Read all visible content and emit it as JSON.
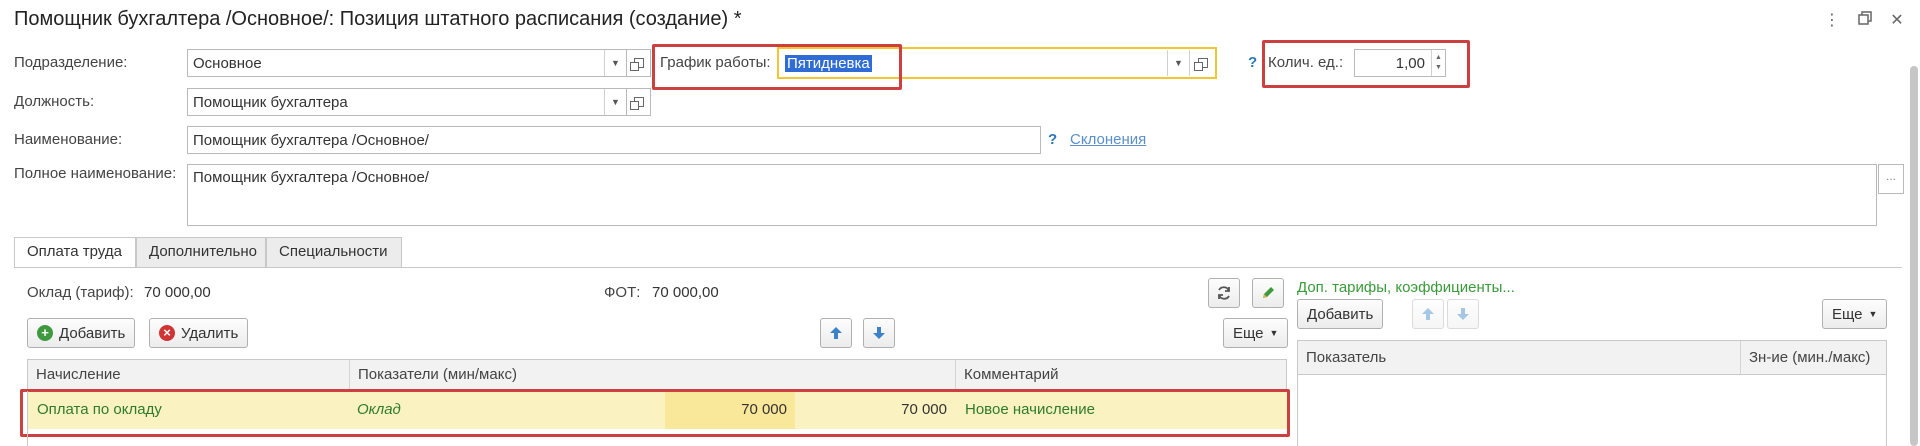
{
  "window": {
    "title": "Помощник бухгалтера /Основное/: Позиция штатного расписания (создание) *",
    "menu_icon": "more-vertical-icon",
    "restore_icon": "restore-window-icon",
    "close_icon": "close-icon"
  },
  "form": {
    "subdivision": {
      "label": "Подразделение:",
      "value": "Основное"
    },
    "position": {
      "label": "Должность:",
      "value": "Помощник бухгалтера"
    },
    "name": {
      "label": "Наименование:",
      "value": "Помощник бухгалтера /Основное/"
    },
    "full_name": {
      "label": "Полное наименование:",
      "value": "Помощник бухгалтера /Основное/"
    },
    "schedule": {
      "label": "График работы:",
      "value": "Пятидневка"
    },
    "quantity": {
      "label": "Колич. ед.:",
      "value": "1,00"
    },
    "declension_link": "Склонения",
    "help": "?"
  },
  "tabs": [
    {
      "label": "Оплата труда",
      "active": true
    },
    {
      "label": "Дополнительно",
      "active": false
    },
    {
      "label": "Специальности",
      "active": false
    }
  ],
  "pay": {
    "salary_label": "Оклад (тариф):",
    "salary_value": "70 000,00",
    "fot_label": "ФОТ:",
    "fot_value": "70 000,00",
    "add_label": "Добавить",
    "delete_label": "Удалить",
    "more_label": "Еще",
    "columns": [
      "Начисление",
      "Показатели (мин/макс)",
      "Комментарий"
    ],
    "rows": [
      {
        "accrual": "Оплата по окладу",
        "indicator": "Оклад",
        "min": "70 000",
        "max": "70 000",
        "comment": "Новое начисление"
      }
    ]
  },
  "extra": {
    "link": "Доп. тарифы, коэффициенты...",
    "add_label": "Добавить",
    "more_label": "Еще",
    "columns": [
      "Показатель",
      "Зн-ие (мин./макс)"
    ]
  },
  "colors": {
    "highlight_box": "#cc4040",
    "selected_row": "#fbf2c2",
    "link_green": "#3a9a3a",
    "accent_blue": "#2c78b5"
  }
}
